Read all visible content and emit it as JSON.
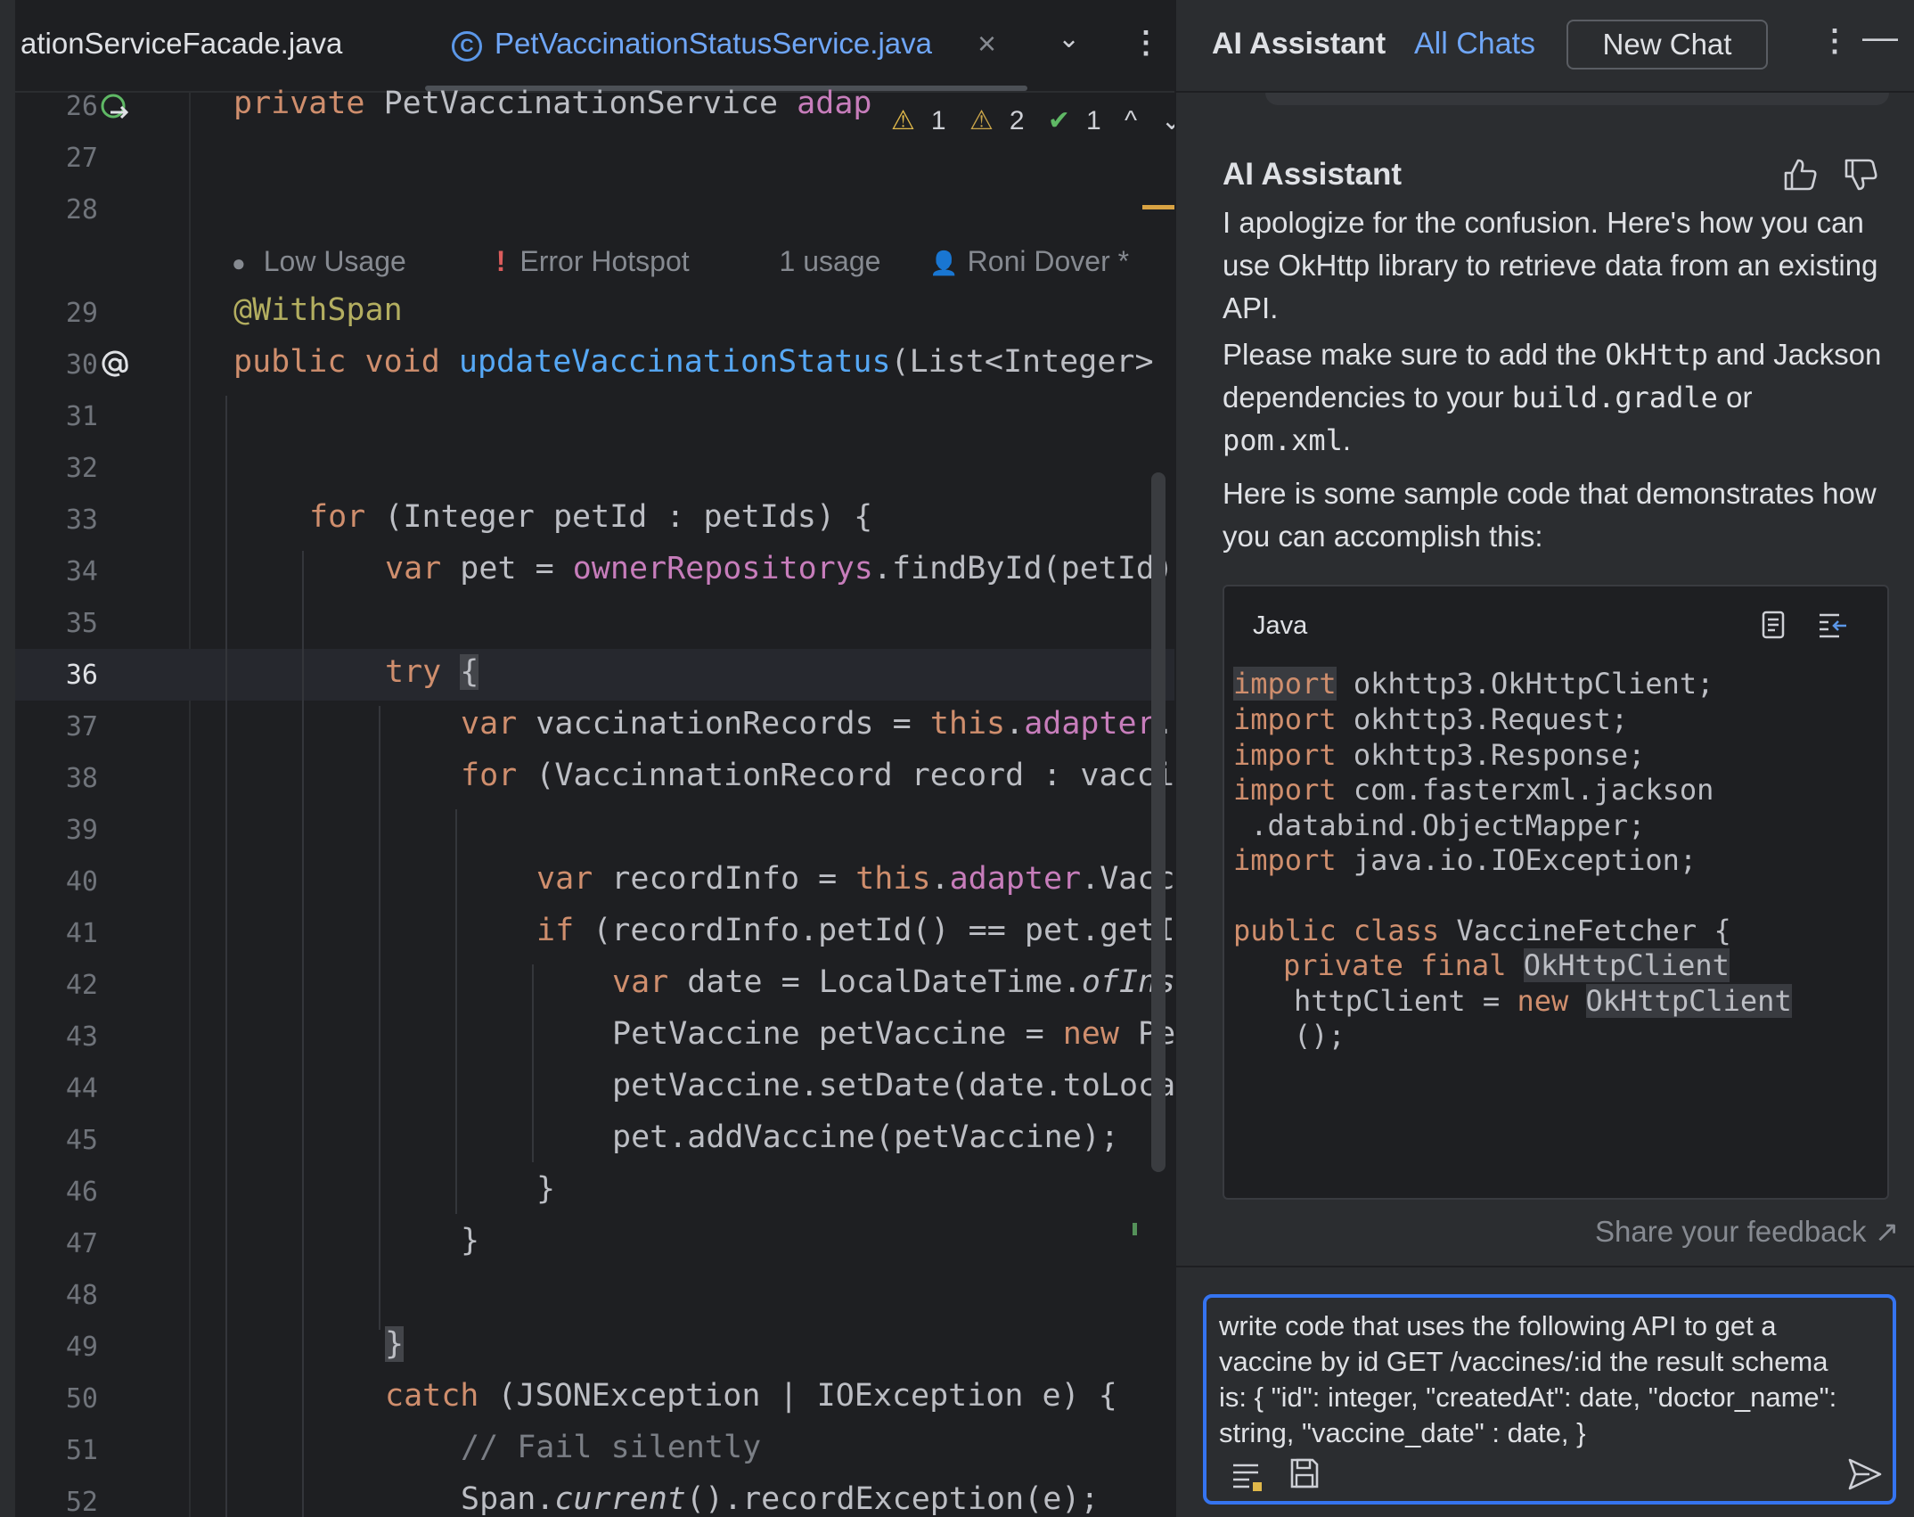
{
  "editor": {
    "tabs": [
      {
        "label": "ationServiceFacade.java"
      },
      {
        "label": "PetVaccinationStatusService.java",
        "icon": "class-icon",
        "icon_glyph": "C"
      }
    ],
    "tab_close": "×",
    "tab_chevron": "⌄",
    "tab_more": "⋮",
    "line_numbers": [
      "26",
      "27",
      "28",
      "29",
      "30",
      "31",
      "32",
      "33",
      "34",
      "35",
      "36",
      "37",
      "38",
      "39",
      "40",
      "41",
      "42",
      "43",
      "44",
      "45",
      "46",
      "47",
      "48",
      "49",
      "50",
      "51",
      "52"
    ],
    "current_line": "36",
    "inspections": {
      "warn1": "1",
      "warn2": "2",
      "ok": "1",
      "up": "^",
      "down": "⌄"
    },
    "hints": {
      "low_usage": "Low Usage",
      "error_hotspot": "Error Hotspot",
      "usage": "1 usage",
      "author": "Roni Dover *"
    },
    "code": {
      "l26_kw": "private ",
      "l26_type": "PetVaccinationService ",
      "l26_field": "adap",
      "l29": "@WithSpan",
      "l30_kw": "public void ",
      "l30_fn": "updateVaccinationStatus",
      "l30_rest": "(List<Integer>",
      "l33_kw": "for ",
      "l33_rest": "(Integer petId : petIds) {",
      "l34_kw": "var ",
      "l34_a": "pet = ",
      "l34_field": "ownerRepositorys",
      "l34_rest": ".findById(petId)",
      "l36_kw": "try ",
      "l36_rest": "{",
      "l37_kw": "var ",
      "l37_a": "vaccinationRecords = ",
      "l37_this": "this",
      "l37_dot": ".",
      "l37_field": "adapter",
      "l37_rest": ".",
      "l38_kw": "for ",
      "l38_rest": "(VaccinnationRecord record : vacci",
      "l40_kw": "var ",
      "l40_a": "recordInfo = ",
      "l40_this": "this",
      "l40_dot": ".",
      "l40_field": "adapter",
      "l40_rest": ".Vacc",
      "l41_kw": "if ",
      "l41_rest": "(recordInfo.petId() == pet.getI",
      "l42_kw": "var ",
      "l42_a": "date = LocalDateTime.",
      "l42_it": "ofIns",
      "l43_a": "PetVaccine petVaccine = ",
      "l43_kw": "new ",
      "l43_rest": "Pe",
      "l44": "petVaccine.setDate(date.toLoca",
      "l45": "pet.addVaccine(petVaccine);",
      "l46": "}",
      "l47": "}",
      "l49": "}",
      "l50_kw": "catch ",
      "l50_rest": "(JSONException | IOException e) {",
      "l51": "// Fail silently",
      "l52_a": "Span.",
      "l52_it": "current",
      "l52_rest": "().recordException(e);"
    }
  },
  "assistant": {
    "title": "AI Assistant",
    "all_chats": "All Chats",
    "new_chat": "New Chat",
    "more": "⋮",
    "minimize": "—",
    "message": {
      "author": "AI Assistant",
      "p1": "I apologize for the confusion. Here's how you can use OkHttp library to retrieve data from an existing API.",
      "p2_a": "Please make sure to add the ",
      "p2_okhttp": "OkHttp",
      "p2_b": " and Jackson dependencies to your ",
      "p2_gradle": "build.gradle",
      "p2_c": " or ",
      "p2_pom": "pom.xml",
      "p2_d": ".",
      "p3": "Here is some sample code that demonstrates how you can accomplish this:"
    },
    "code_block": {
      "language": "Java",
      "lines": {
        "i1_kw": "import",
        "i1": " okhttp3.OkHttpClient;",
        "i2_kw": "import",
        "i2": " okhttp3.Request;",
        "i3_kw": "import",
        "i3": " okhttp3.Response;",
        "i4_kw": "import",
        "i4": " com.fasterxml.jackson",
        "i4b": " .databind.ObjectMapper;",
        "i5_kw": "import",
        "i5": " java.io.IOException;",
        "c1_kw": "public class ",
        "c1": "VaccineFetcher {",
        "c2_kw": "private final ",
        "c2_hl": "OkHttpClient",
        "c3": "httpClient = ",
        "c3_kw": "new ",
        "c3_hl": "OkHttpClient",
        "c4": "();"
      }
    },
    "feedback": "Share your feedback ↗",
    "input": {
      "value": "write code that uses the following API to get a   vaccine by id GET /vaccines/:id the result   schema is: { \"id\": integer, \"createdAt\": date,   \"doctor_name\": string, \"vaccine_date\" : date, }"
    }
  },
  "colors": {
    "background": "#1e1f22",
    "panel": "#2b2d30",
    "accent": "#3574f0",
    "keyword": "#cf8e6d",
    "function": "#56a8f5",
    "field": "#c77dbb",
    "annotation": "#b3ae60"
  }
}
